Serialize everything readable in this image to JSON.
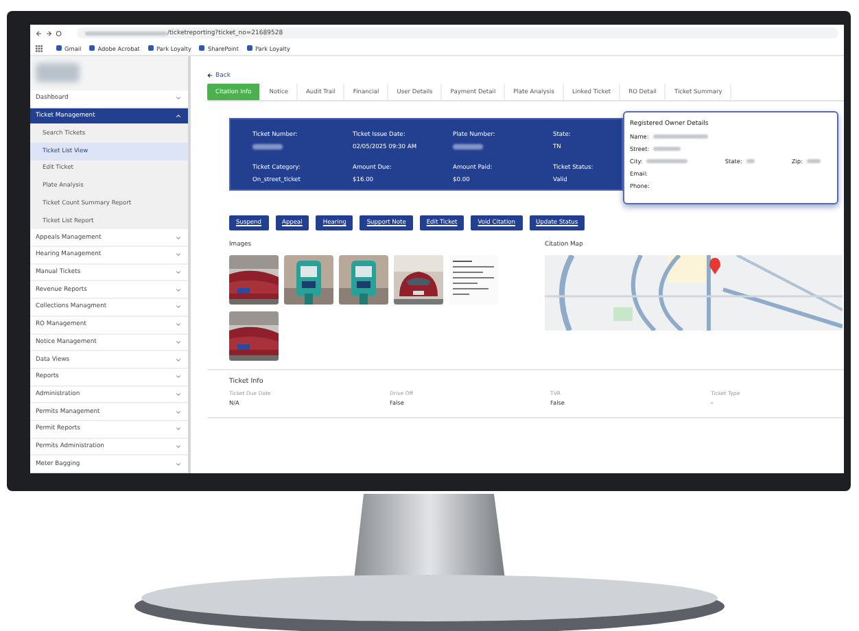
{
  "browser": {
    "url": "/ticketreporting?ticket_no=21689528",
    "bookmarks": [
      {
        "label": "Gmail"
      },
      {
        "label": "Adobe Acrobat"
      },
      {
        "label": "Park Loyalty"
      },
      {
        "label": "SharePoint"
      },
      {
        "label": "Park Loyalty"
      }
    ]
  },
  "sidebar": {
    "items": [
      {
        "label": "Dashboard",
        "expanded": false,
        "selected": false
      },
      {
        "label": "Ticket Management",
        "expanded": true,
        "selected": true,
        "children": [
          {
            "label": "Search Tickets",
            "selected": false
          },
          {
            "label": "Ticket List View",
            "selected": true
          },
          {
            "label": "Edit Ticket",
            "selected": false
          },
          {
            "label": "Plate Analysis",
            "selected": false
          },
          {
            "label": "Ticket Count Summary Report",
            "selected": false
          },
          {
            "label": "Ticket List Report",
            "selected": false
          }
        ]
      },
      {
        "label": "Appeals Management",
        "expanded": false,
        "selected": false
      },
      {
        "label": "Hearing Management",
        "expanded": false,
        "selected": false
      },
      {
        "label": "Manual Tickets",
        "expanded": false,
        "selected": false
      },
      {
        "label": "Revenue Reports",
        "expanded": false,
        "selected": false
      },
      {
        "label": "Collections Managment",
        "expanded": false,
        "selected": false
      },
      {
        "label": "RO Management",
        "expanded": false,
        "selected": false
      },
      {
        "label": "Notice Management",
        "expanded": false,
        "selected": false
      },
      {
        "label": "Data Views",
        "expanded": false,
        "selected": false
      },
      {
        "label": "Reports",
        "expanded": false,
        "selected": false
      },
      {
        "label": "Administration",
        "expanded": false,
        "selected": false
      },
      {
        "label": "Permits Management",
        "expanded": false,
        "selected": false
      },
      {
        "label": "Permit Reports",
        "expanded": false,
        "selected": false
      },
      {
        "label": "Permits Administration",
        "expanded": false,
        "selected": false
      },
      {
        "label": "Meter Bagging",
        "expanded": false,
        "selected": false
      }
    ]
  },
  "back_link": "Back",
  "tabs": [
    {
      "label": "Citation Info",
      "selected": true
    },
    {
      "label": "Notice",
      "selected": false
    },
    {
      "label": "Audit Trail",
      "selected": false
    },
    {
      "label": "Financial",
      "selected": false
    },
    {
      "label": "User Details",
      "selected": false
    },
    {
      "label": "Payment Detail",
      "selected": false
    },
    {
      "label": "Plate Analysis",
      "selected": false
    },
    {
      "label": "Linked Ticket",
      "selected": false
    },
    {
      "label": "RO Detail",
      "selected": false
    },
    {
      "label": "Ticket Summary",
      "selected": false
    }
  ],
  "summary": [
    {
      "label": "Ticket Number:"
    },
    {
      "label": "Ticket Issue Date:",
      "value": "02/05/2025 09:30 AM"
    },
    {
      "label": "Plate Number:"
    },
    {
      "label": "State:",
      "value": "TN"
    },
    {
      "label": "Ticket Category:",
      "value": "On_street_ticket"
    },
    {
      "label": "Amount Due:",
      "value": "$16.00"
    },
    {
      "label": "Amount Paid:",
      "value": "$0.00"
    },
    {
      "label": "Ticket Status:",
      "value": "Valid"
    }
  ],
  "owner_details": {
    "title": "Registered Owner Details",
    "fields": [
      {
        "label": "Name:"
      },
      {
        "label": "Street:"
      },
      {
        "label": "City:"
      },
      {
        "label": "State:"
      },
      {
        "label": "Zip:"
      },
      {
        "label": "Email:"
      },
      {
        "label": "Phone:"
      }
    ]
  },
  "actions": [
    "Suspend",
    "Appeal",
    "Hearing",
    "Support Note",
    "Edit Ticket",
    "Void Citation",
    "Update Status"
  ],
  "images": {
    "title": "Images"
  },
  "map": {
    "title": "Citation Map",
    "kind": "picture"
  },
  "ticket_info": {
    "title": "Ticket Info",
    "fields": [
      {
        "label": "Ticket Due Date",
        "value": "N/A"
      },
      {
        "label": "Drive Off",
        "value": "False"
      },
      {
        "label": "TVR",
        "value": "False"
      },
      {
        "label": "Ticket Type",
        "value": "-"
      }
    ]
  }
}
